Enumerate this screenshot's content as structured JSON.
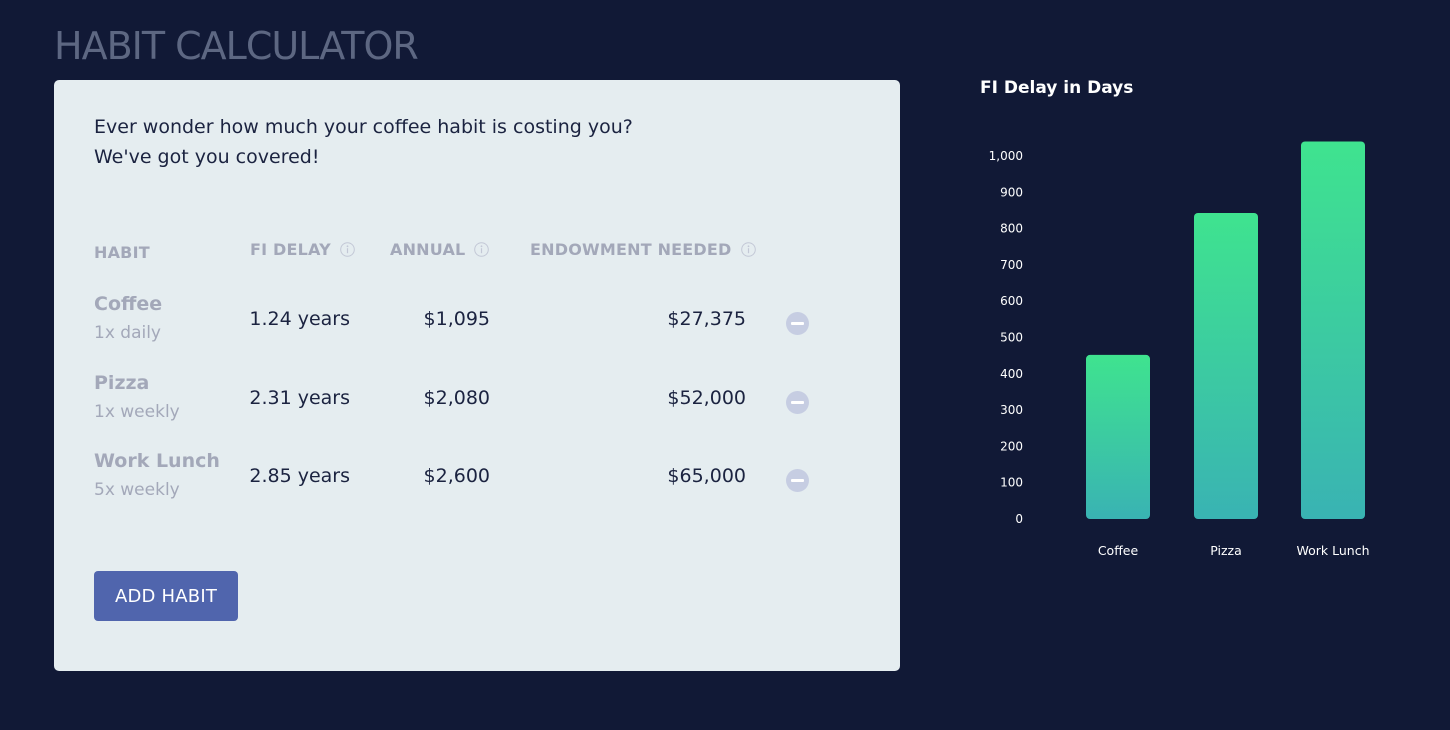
{
  "app": {
    "title": "HABIT CALCULATOR"
  },
  "intro": {
    "line1": "Ever wonder how much your coffee habit is costing you?",
    "line2": "We've got you covered!"
  },
  "table": {
    "headers": {
      "habit": "HABIT",
      "fi_delay": "FI DELAY",
      "annual": "ANNUAL",
      "endowment": "ENDOWMENT NEEDED"
    },
    "rows": [
      {
        "name": "Coffee",
        "frequency": "1x daily",
        "fi_delay": "1.24 years",
        "annual": "$1,095",
        "endowment": "$27,375"
      },
      {
        "name": "Pizza",
        "frequency": "1x weekly",
        "fi_delay": "2.31 years",
        "annual": "$2,080",
        "endowment": "$52,000"
      },
      {
        "name": "Work Lunch",
        "frequency": "5x weekly",
        "fi_delay": "2.85 years",
        "annual": "$2,600",
        "endowment": "$65,000"
      }
    ]
  },
  "actions": {
    "add_habit": "ADD HABIT"
  },
  "icons": {
    "info": "info-icon",
    "remove": "minus-circle-icon"
  },
  "colors": {
    "background": "#111936",
    "card": "#e5edf0",
    "accent_button": "#5065ad",
    "bar_top": "#3fe38f",
    "bar_bottom": "#39b3b3"
  },
  "chart_data": {
    "type": "bar",
    "title": "FI Delay in Days",
    "categories": [
      "Coffee",
      "Pizza",
      "Work Lunch"
    ],
    "values": [
      452,
      843,
      1040
    ],
    "ylim": [
      0,
      1000
    ],
    "yticks": [
      0,
      100,
      200,
      300,
      400,
      500,
      600,
      700,
      800,
      900,
      1000
    ],
    "ytick_labels": [
      "0",
      "100",
      "200",
      "300",
      "400",
      "500",
      "600",
      "700",
      "800",
      "900",
      "1,000"
    ],
    "grid": false,
    "legend": "none"
  }
}
